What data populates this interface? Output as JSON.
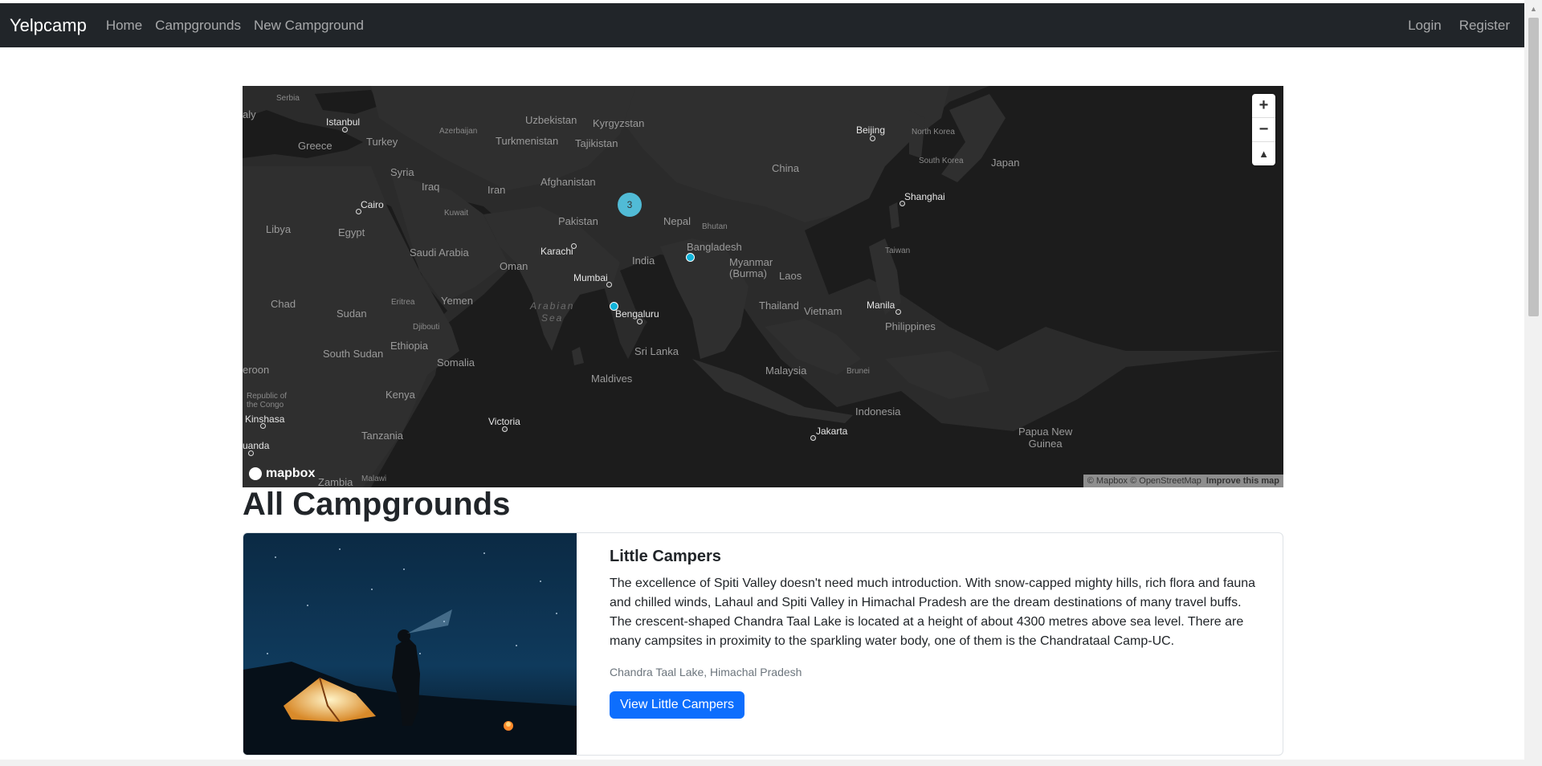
{
  "navbar": {
    "brand": "Yelpcamp",
    "links": [
      "Home",
      "Campgrounds",
      "New Campground"
    ],
    "right_links": [
      "Login",
      "Register"
    ]
  },
  "map": {
    "labels": {
      "serbia": "Serbia",
      "italy": "aly",
      "istanbul": "Istanbul",
      "greece": "Greece",
      "turkey": "Turkey",
      "azerbaijan": "Azerbaijan",
      "uzbekistan": "Uzbekistan",
      "kyrgyzstan": "Kyrgyzstan",
      "turkmenistan": "Turkmenistan",
      "tajikistan": "Tajikistan",
      "beijing": "Beijing",
      "north_korea": "North Korea",
      "south_korea": "South Korea",
      "japan": "Japan",
      "syria": "Syria",
      "iraq": "Iraq",
      "iran": "Iran",
      "afghanistan": "Afghanistan",
      "china": "China",
      "cairo": "Cairo",
      "kuwait": "Kuwait",
      "pakistan": "Pakistan",
      "nepal": "Nepal",
      "bhutan": "Bhutan",
      "shanghai": "Shanghai",
      "libya": "Libya",
      "egypt": "Egypt",
      "karachi": "Karachi",
      "bangladesh": "Bangladesh",
      "saudi_arabia": "Saudi Arabia",
      "oman": "Oman",
      "india": "India",
      "taiwan": "Taiwan",
      "myanmar": "Myanmar\n(Burma)",
      "laos": "Laos",
      "mumbai": "Mumbai",
      "chad": "Chad",
      "sudan": "Sudan",
      "eritrea": "Eritrea",
      "yemen": "Yemen",
      "arabian_sea": "Arabian\nSea",
      "bengaluru": "Bengaluru",
      "thailand": "Thailand",
      "vietnam": "Vietnam",
      "manila": "Manila",
      "djibouti": "Djibouti",
      "philippines": "Philippines",
      "south_sudan": "South Sudan",
      "ethiopia": "Ethiopia",
      "sri_lanka": "Sri Lanka",
      "somalia": "Somalia",
      "cameroon": "eroon",
      "malaysia": "Malaysia",
      "brunei": "Brunei",
      "maldives": "Maldives",
      "republic_congo": "Republic of\nthe Congo",
      "kenya": "Kenya",
      "indonesia": "Indonesia",
      "kinshasa": "Kinshasa",
      "victoria": "Victoria",
      "tanzania": "Tanzania",
      "jakarta": "Jakarta",
      "papua": "Papua New\nGuinea",
      "luanda": "uanda",
      "zambia": "Zambia",
      "malawi": "Malawi"
    },
    "cluster_count": "3",
    "controls": {
      "zoom_in": "+",
      "zoom_out": "−",
      "compass": "▲"
    },
    "logo": "mapbox",
    "attribution": "© Mapbox © OpenStreetMap",
    "improve": "Improve this map"
  },
  "page": {
    "heading": "All Campgrounds"
  },
  "campgrounds": [
    {
      "title": "Little Campers",
      "description": "The excellence of Spiti Valley doesn't need much introduction. With snow-capped mighty hills, rich flora and fauna and chilled winds, Lahaul and Spiti Valley in Himachal Pradesh are the dream destinations of many travel buffs. The crescent-shaped Chandra Taal Lake is located at a height of about 4300 metres above sea level. There are many campsites in proximity to the sparkling water body, one of them is the Chandrataal Camp-UC.",
      "location": "Chandra Taal Lake, Himachal Pradesh",
      "button": "View Little Campers"
    }
  ],
  "colors": {
    "navbar_bg": "#212529",
    "primary": "#0d6efd",
    "cluster": "#51bbd6",
    "marker": "#11b4da",
    "map_land": "#2b2b2b",
    "map_water": "#1a1a1a"
  }
}
